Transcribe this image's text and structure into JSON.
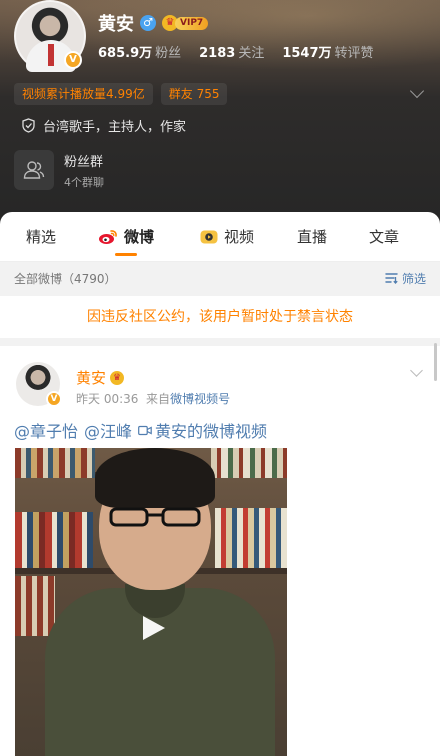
{
  "profile": {
    "name": "黄安",
    "gender_symbol": "♂",
    "vip_label": "VIP7",
    "avatar_badge": "V",
    "stats": [
      {
        "value": "685.9万",
        "label": "粉丝"
      },
      {
        "value": "2183",
        "label": "关注"
      },
      {
        "value": "1547万",
        "label": "转评赞"
      }
    ],
    "pills": [
      {
        "label": "视频累计播放量4.99亿"
      },
      {
        "label": "群友",
        "count": "755"
      }
    ],
    "verification": "台湾歌手，主持人，作家",
    "fan_group": {
      "title": "粉丝群",
      "subtitle": "4个群聊"
    }
  },
  "tabs": [
    {
      "label": "精选",
      "active": false
    },
    {
      "label": "微博",
      "active": true,
      "icon": "weibo-icon"
    },
    {
      "label": "视频",
      "active": false,
      "icon": "video-icon"
    },
    {
      "label": "直播",
      "active": false
    },
    {
      "label": "文章",
      "active": false
    }
  ],
  "filter_bar": {
    "all_posts_label": "全部微博（4790）",
    "filter_label": "筛选"
  },
  "ban_notice": "因违反社区公约，该用户暂时处于禁言状态",
  "post": {
    "author": "黄安",
    "avatar_badge": "V",
    "time": "昨天 00:36",
    "source_prefix": "来自",
    "source": "微博视频号",
    "mentions": [
      "@章子怡",
      "@汪峰"
    ],
    "video_link": "黄安的微博视频"
  },
  "colors": {
    "accent": "#ff8200",
    "link": "#507daf",
    "header_bg": "#262626"
  }
}
